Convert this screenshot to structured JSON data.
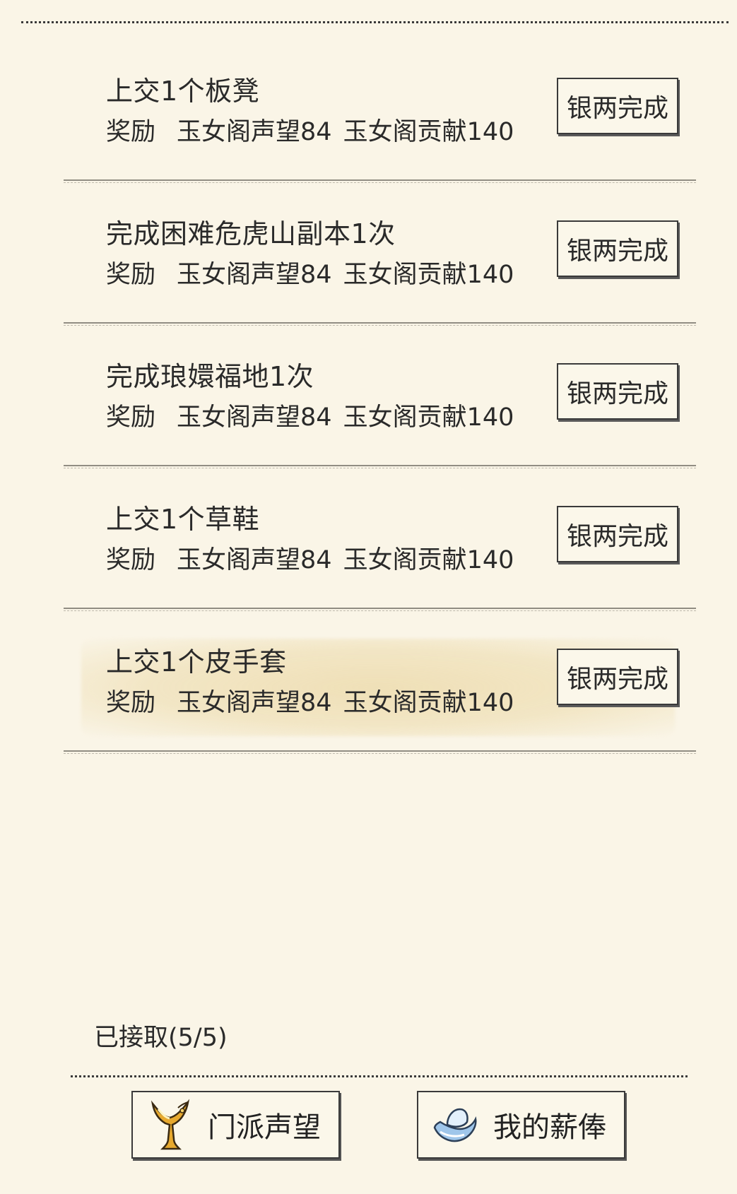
{
  "tasks": [
    {
      "title": "上交1个板凳",
      "reward_label": "奖励",
      "reward_1": "玉女阁声望84",
      "reward_2": "玉女阁贡献140",
      "button": "银两完成",
      "highlighted": false
    },
    {
      "title": "完成困难危虎山副本1次",
      "reward_label": "奖励",
      "reward_1": "玉女阁声望84",
      "reward_2": "玉女阁贡献140",
      "button": "银两完成",
      "highlighted": false
    },
    {
      "title": "完成琅嬛福地1次",
      "reward_label": "奖励",
      "reward_1": "玉女阁声望84",
      "reward_2": "玉女阁贡献140",
      "button": "银两完成",
      "highlighted": false
    },
    {
      "title": "上交1个草鞋",
      "reward_label": "奖励",
      "reward_1": "玉女阁声望84",
      "reward_2": "玉女阁贡献140",
      "button": "银两完成",
      "highlighted": false
    },
    {
      "title": "上交1个皮手套",
      "reward_label": "奖励",
      "reward_1": "玉女阁声望84",
      "reward_2": "玉女阁贡献140",
      "button": "银两完成",
      "highlighted": true
    }
  ],
  "status": {
    "accepted": "已接取(5/5)"
  },
  "bottom_buttons": {
    "sect_reputation": {
      "label": "门派声望",
      "icon": "golden-cup-icon"
    },
    "my_salary": {
      "label": "我的薪俸",
      "icon": "silver-ingot-icon"
    }
  }
}
